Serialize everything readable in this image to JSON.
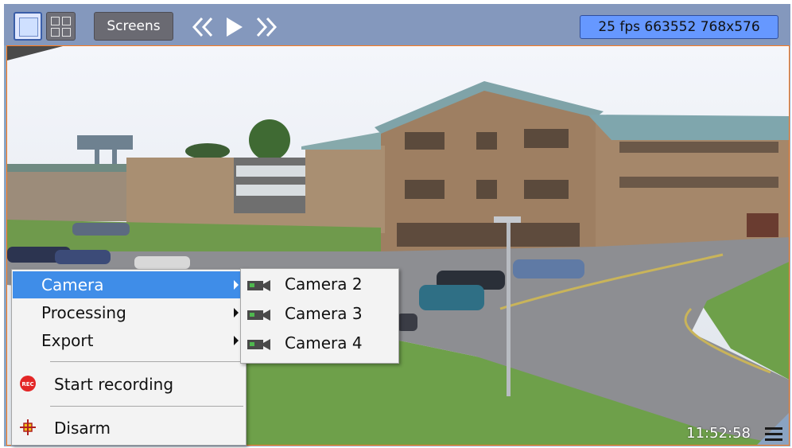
{
  "toolbar": {
    "screens_label": "Screens",
    "status_text": "25 fps 663552 768x576"
  },
  "video": {
    "timestamp": "11:52:58"
  },
  "context_menu": {
    "items": [
      {
        "label": "Camera"
      },
      {
        "label": "Processing"
      },
      {
        "label": "Export"
      }
    ],
    "actions": [
      {
        "label": "Start recording",
        "icon": "rec-icon"
      },
      {
        "label": "Disarm",
        "icon": "disarm-icon"
      }
    ]
  },
  "camera_submenu": {
    "items": [
      {
        "label": "Camera 2",
        "icon": "camera-icon"
      },
      {
        "label": "Camera 3",
        "icon": "camera-icon"
      },
      {
        "label": "Camera 4",
        "icon": "camera-icon"
      }
    ]
  },
  "colors": {
    "toolbar_bg": "#8498bd",
    "status_bg": "#6698ff",
    "selected_item": "#3f8de8",
    "video_border": "#ff7a1a"
  }
}
